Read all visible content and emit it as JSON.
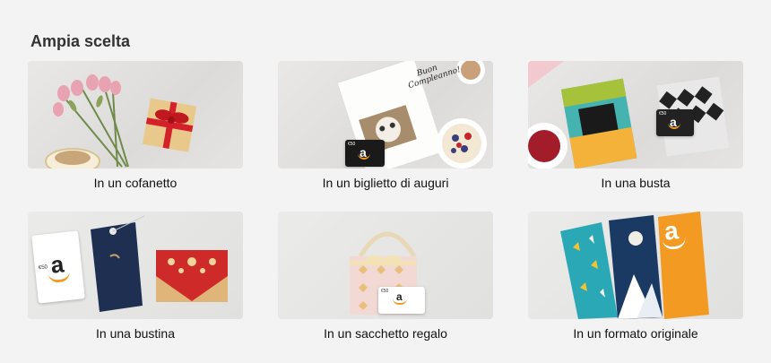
{
  "section": {
    "title": "Ampia scelta"
  },
  "tiles": [
    {
      "caption": "In un cofanetto"
    },
    {
      "caption": "In un biglietto di auguri",
      "card_text": "Buon Compleanno!",
      "value_tag": "€50"
    },
    {
      "caption": "In una busta",
      "value_tag": "€50"
    },
    {
      "caption": "In una bustina",
      "value_tag": "€50"
    },
    {
      "caption": "In un sacchetto regalo",
      "value_tag": "€50"
    },
    {
      "caption": "In un formato originale"
    }
  ],
  "colors": {
    "background": "#f3f3f3",
    "amazon_orange": "#f29a22",
    "ribbon_red": "#d4202a",
    "envelope_navy": "#1f2f52"
  }
}
